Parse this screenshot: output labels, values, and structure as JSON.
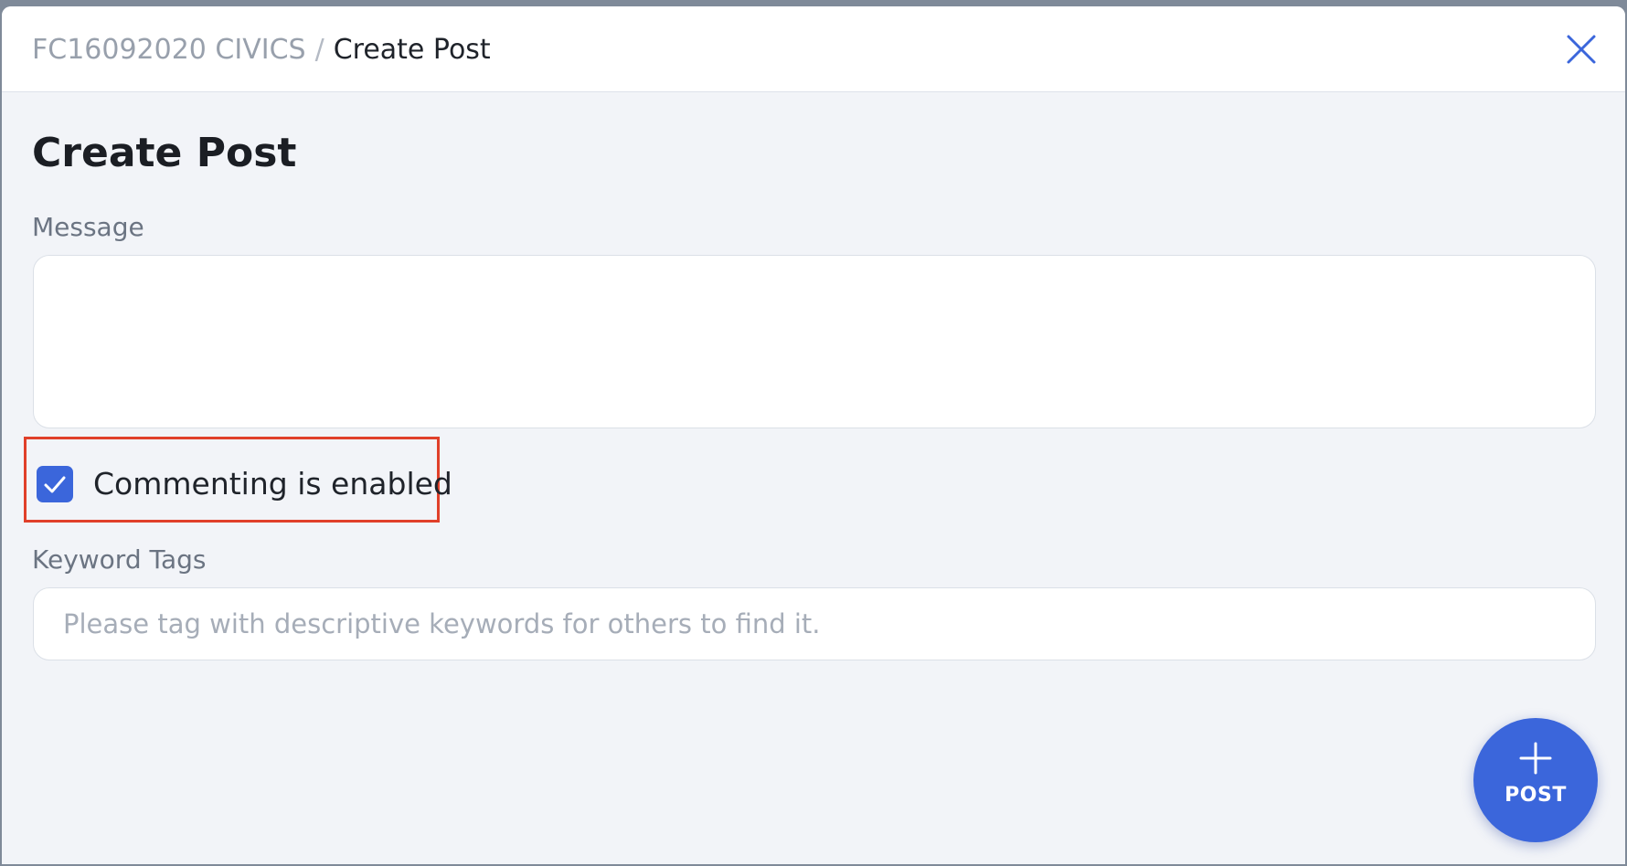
{
  "header": {
    "breadcrumb_parent": "FC16092020 CIVICS",
    "breadcrumb_separator": "/",
    "breadcrumb_current": "Create Post",
    "close_icon": "close-icon"
  },
  "form": {
    "title": "Create Post",
    "message_label": "Message",
    "message_value": "",
    "commenting_label": "Commenting is enabled",
    "commenting_checked": true,
    "tags_label": "Keyword Tags",
    "tags_placeholder": "Please tag with descriptive keywords for others to find it.",
    "tags_value": ""
  },
  "actions": {
    "post_label": "POST",
    "post_icon": "plus-icon"
  },
  "colors": {
    "accent": "#3b66db",
    "highlight_border": "#e0402a"
  }
}
